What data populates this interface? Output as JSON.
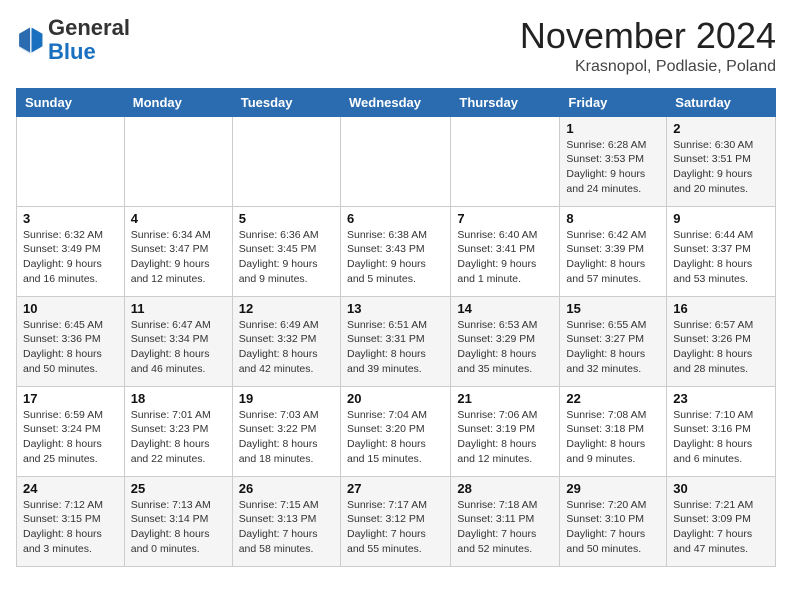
{
  "header": {
    "logo_general": "General",
    "logo_blue": "Blue",
    "month_title": "November 2024",
    "subtitle": "Krasnopol, Podlasie, Poland"
  },
  "weekdays": [
    "Sunday",
    "Monday",
    "Tuesday",
    "Wednesday",
    "Thursday",
    "Friday",
    "Saturday"
  ],
  "weeks": [
    [
      {
        "day": "",
        "info": ""
      },
      {
        "day": "",
        "info": ""
      },
      {
        "day": "",
        "info": ""
      },
      {
        "day": "",
        "info": ""
      },
      {
        "day": "",
        "info": ""
      },
      {
        "day": "1",
        "info": "Sunrise: 6:28 AM\nSunset: 3:53 PM\nDaylight: 9 hours and 24 minutes."
      },
      {
        "day": "2",
        "info": "Sunrise: 6:30 AM\nSunset: 3:51 PM\nDaylight: 9 hours and 20 minutes."
      }
    ],
    [
      {
        "day": "3",
        "info": "Sunrise: 6:32 AM\nSunset: 3:49 PM\nDaylight: 9 hours and 16 minutes."
      },
      {
        "day": "4",
        "info": "Sunrise: 6:34 AM\nSunset: 3:47 PM\nDaylight: 9 hours and 12 minutes."
      },
      {
        "day": "5",
        "info": "Sunrise: 6:36 AM\nSunset: 3:45 PM\nDaylight: 9 hours and 9 minutes."
      },
      {
        "day": "6",
        "info": "Sunrise: 6:38 AM\nSunset: 3:43 PM\nDaylight: 9 hours and 5 minutes."
      },
      {
        "day": "7",
        "info": "Sunrise: 6:40 AM\nSunset: 3:41 PM\nDaylight: 9 hours and 1 minute."
      },
      {
        "day": "8",
        "info": "Sunrise: 6:42 AM\nSunset: 3:39 PM\nDaylight: 8 hours and 57 minutes."
      },
      {
        "day": "9",
        "info": "Sunrise: 6:44 AM\nSunset: 3:37 PM\nDaylight: 8 hours and 53 minutes."
      }
    ],
    [
      {
        "day": "10",
        "info": "Sunrise: 6:45 AM\nSunset: 3:36 PM\nDaylight: 8 hours and 50 minutes."
      },
      {
        "day": "11",
        "info": "Sunrise: 6:47 AM\nSunset: 3:34 PM\nDaylight: 8 hours and 46 minutes."
      },
      {
        "day": "12",
        "info": "Sunrise: 6:49 AM\nSunset: 3:32 PM\nDaylight: 8 hours and 42 minutes."
      },
      {
        "day": "13",
        "info": "Sunrise: 6:51 AM\nSunset: 3:31 PM\nDaylight: 8 hours and 39 minutes."
      },
      {
        "day": "14",
        "info": "Sunrise: 6:53 AM\nSunset: 3:29 PM\nDaylight: 8 hours and 35 minutes."
      },
      {
        "day": "15",
        "info": "Sunrise: 6:55 AM\nSunset: 3:27 PM\nDaylight: 8 hours and 32 minutes."
      },
      {
        "day": "16",
        "info": "Sunrise: 6:57 AM\nSunset: 3:26 PM\nDaylight: 8 hours and 28 minutes."
      }
    ],
    [
      {
        "day": "17",
        "info": "Sunrise: 6:59 AM\nSunset: 3:24 PM\nDaylight: 8 hours and 25 minutes."
      },
      {
        "day": "18",
        "info": "Sunrise: 7:01 AM\nSunset: 3:23 PM\nDaylight: 8 hours and 22 minutes."
      },
      {
        "day": "19",
        "info": "Sunrise: 7:03 AM\nSunset: 3:22 PM\nDaylight: 8 hours and 18 minutes."
      },
      {
        "day": "20",
        "info": "Sunrise: 7:04 AM\nSunset: 3:20 PM\nDaylight: 8 hours and 15 minutes."
      },
      {
        "day": "21",
        "info": "Sunrise: 7:06 AM\nSunset: 3:19 PM\nDaylight: 8 hours and 12 minutes."
      },
      {
        "day": "22",
        "info": "Sunrise: 7:08 AM\nSunset: 3:18 PM\nDaylight: 8 hours and 9 minutes."
      },
      {
        "day": "23",
        "info": "Sunrise: 7:10 AM\nSunset: 3:16 PM\nDaylight: 8 hours and 6 minutes."
      }
    ],
    [
      {
        "day": "24",
        "info": "Sunrise: 7:12 AM\nSunset: 3:15 PM\nDaylight: 8 hours and 3 minutes."
      },
      {
        "day": "25",
        "info": "Sunrise: 7:13 AM\nSunset: 3:14 PM\nDaylight: 8 hours and 0 minutes."
      },
      {
        "day": "26",
        "info": "Sunrise: 7:15 AM\nSunset: 3:13 PM\nDaylight: 7 hours and 58 minutes."
      },
      {
        "day": "27",
        "info": "Sunrise: 7:17 AM\nSunset: 3:12 PM\nDaylight: 7 hours and 55 minutes."
      },
      {
        "day": "28",
        "info": "Sunrise: 7:18 AM\nSunset: 3:11 PM\nDaylight: 7 hours and 52 minutes."
      },
      {
        "day": "29",
        "info": "Sunrise: 7:20 AM\nSunset: 3:10 PM\nDaylight: 7 hours and 50 minutes."
      },
      {
        "day": "30",
        "info": "Sunrise: 7:21 AM\nSunset: 3:09 PM\nDaylight: 7 hours and 47 minutes."
      }
    ]
  ]
}
